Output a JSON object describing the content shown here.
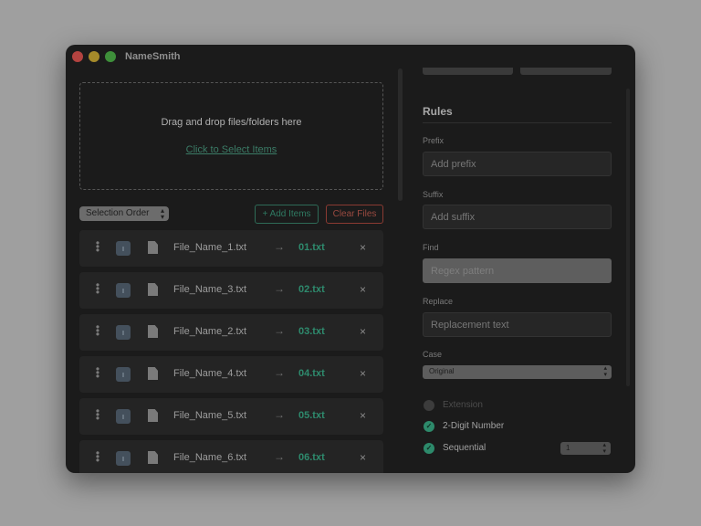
{
  "window": {
    "title": "NameSmith"
  },
  "dropzone": {
    "text": "Drag and drop files/folders here",
    "link": "Click to Select Items"
  },
  "toolbar": {
    "sort_value": "Selection Order",
    "add_label": "+ Add Items",
    "clear_label": "Clear Files"
  },
  "files": [
    {
      "original": "File_Name_1.txt",
      "arrow": "→",
      "renamed": "01.txt",
      "remove": "×"
    },
    {
      "original": "File_Name_3.txt",
      "arrow": "→",
      "renamed": "02.txt",
      "remove": "×"
    },
    {
      "original": "File_Name_2.txt",
      "arrow": "→",
      "renamed": "03.txt",
      "remove": "×"
    },
    {
      "original": "File_Name_4.txt",
      "arrow": "→",
      "renamed": "04.txt",
      "remove": "×"
    },
    {
      "original": "File_Name_5.txt",
      "arrow": "→",
      "renamed": "05.txt",
      "remove": "×"
    },
    {
      "original": "File_Name_6.txt",
      "arrow": "→",
      "renamed": "06.txt",
      "remove": "×"
    }
  ],
  "rules": {
    "heading": "Rules",
    "prefix": {
      "label": "Prefix",
      "placeholder": "Add prefix"
    },
    "suffix": {
      "label": "Suffix",
      "placeholder": "Add suffix"
    },
    "find": {
      "label": "Find",
      "placeholder": "Regex pattern"
    },
    "replace": {
      "label": "Replace",
      "placeholder": "Replacement text"
    },
    "case": {
      "label": "Case",
      "value": "Original"
    },
    "extension": {
      "label": "Extension",
      "checked": false
    },
    "two_digit": {
      "label": "2-Digit Number",
      "checked": true
    },
    "sequential": {
      "label": "Sequential",
      "checked": true,
      "start_value": "1"
    }
  },
  "colors": {
    "accent_green": "#2e8a6d",
    "danger_red": "#9a4a40",
    "window_bg": "#1b1b1b",
    "backdrop": "#9f9f9f"
  },
  "icons": {
    "drag_handle": "grip-vertical-icon",
    "file_type": "file-type-icon",
    "document": "document-icon",
    "remove": "close-icon",
    "checkbox_on": "checkmark-icon"
  }
}
